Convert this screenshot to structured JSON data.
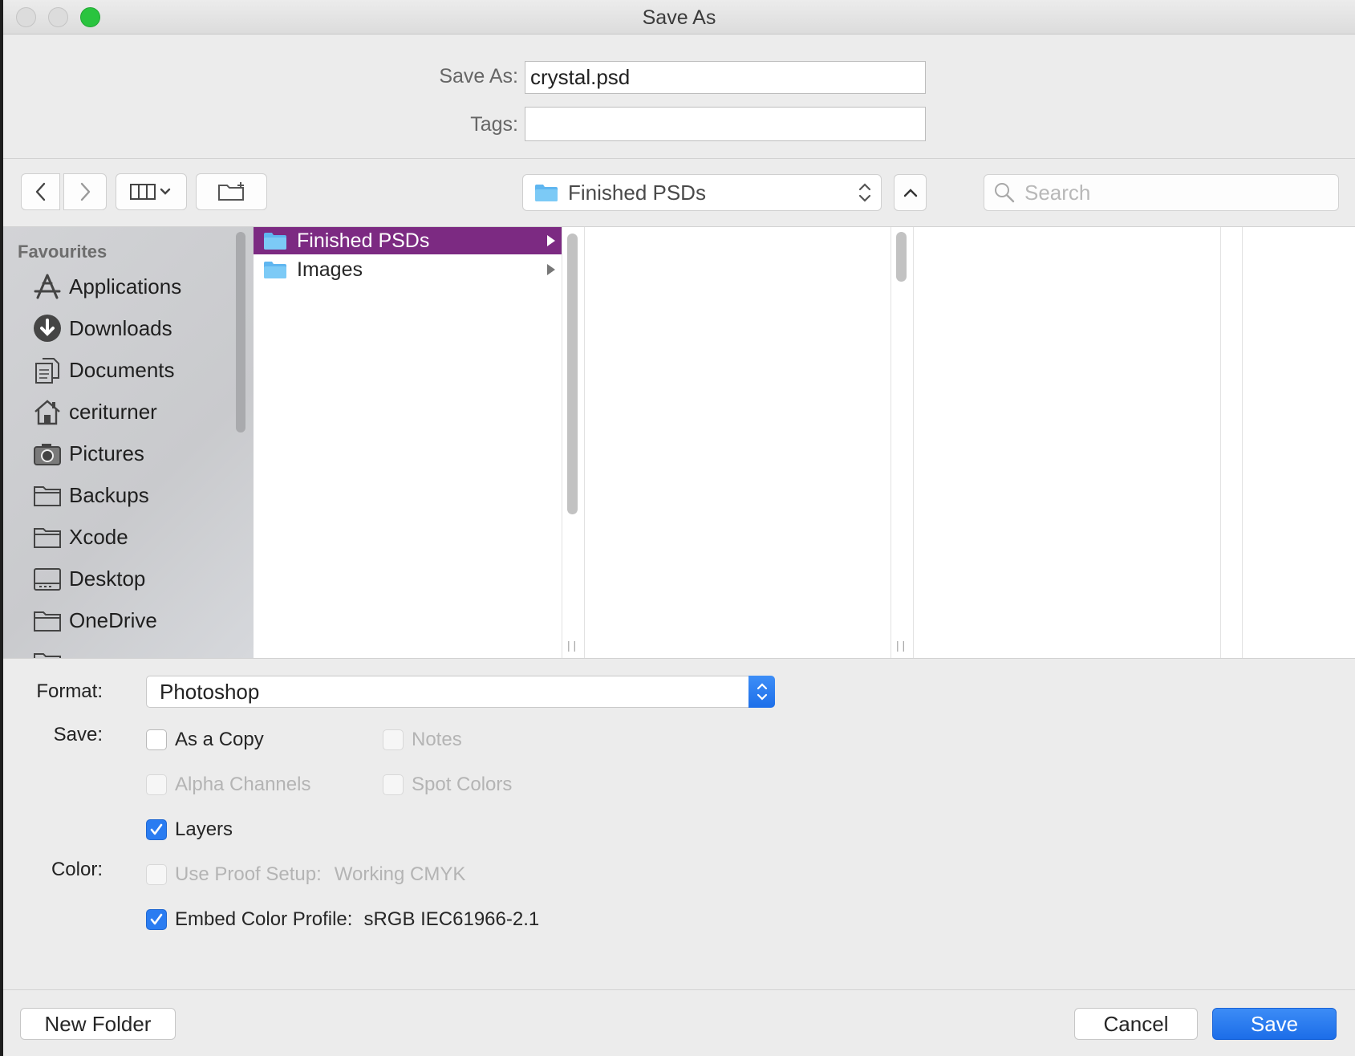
{
  "window": {
    "title": "Save As"
  },
  "form": {
    "save_as_label": "Save As:",
    "filename": "crystal.psd",
    "tags_label": "Tags:",
    "tags_value": ""
  },
  "toolbar": {
    "location": "Finished PSDs",
    "search_placeholder": "Search"
  },
  "sidebar": {
    "heading": "Favourites",
    "items": [
      {
        "label": "Applications",
        "icon": "applications-icon"
      },
      {
        "label": "Downloads",
        "icon": "downloads-icon"
      },
      {
        "label": "Documents",
        "icon": "documents-icon"
      },
      {
        "label": "ceriturner",
        "icon": "home-icon"
      },
      {
        "label": "Pictures",
        "icon": "camera-icon"
      },
      {
        "label": "Backups",
        "icon": "folder-icon"
      },
      {
        "label": "Xcode",
        "icon": "folder-icon"
      },
      {
        "label": "Desktop",
        "icon": "desktop-icon"
      },
      {
        "label": "OneDrive",
        "icon": "folder-icon"
      }
    ]
  },
  "browser": {
    "column1": [
      {
        "label": "Finished PSDs",
        "selected": true
      },
      {
        "label": "Images",
        "selected": false
      }
    ],
    "selection_color": "#7c2a82"
  },
  "options": {
    "format_label": "Format:",
    "format_value": "Photoshop",
    "save_label": "Save:",
    "color_label": "Color:",
    "as_a_copy": {
      "label": "As a Copy",
      "checked": false,
      "enabled": true
    },
    "notes": {
      "label": "Notes",
      "checked": false,
      "enabled": false
    },
    "alpha_channels": {
      "label": "Alpha Channels",
      "checked": false,
      "enabled": false
    },
    "spot_colors": {
      "label": "Spot Colors",
      "checked": false,
      "enabled": false
    },
    "layers": {
      "label": "Layers",
      "checked": true,
      "enabled": true
    },
    "use_proof_setup": {
      "label": "Use Proof Setup:",
      "value": "Working CMYK",
      "checked": false,
      "enabled": false
    },
    "embed_color_profile": {
      "label": "Embed Color Profile:",
      "value": "sRGB IEC61966-2.1",
      "checked": true,
      "enabled": true
    }
  },
  "buttons": {
    "new_folder": "New Folder",
    "cancel": "Cancel",
    "save": "Save"
  },
  "colors": {
    "accent": "#1f6fe8",
    "close_traffic": "#dcdcdc",
    "zoom_traffic": "#2ac43f"
  }
}
